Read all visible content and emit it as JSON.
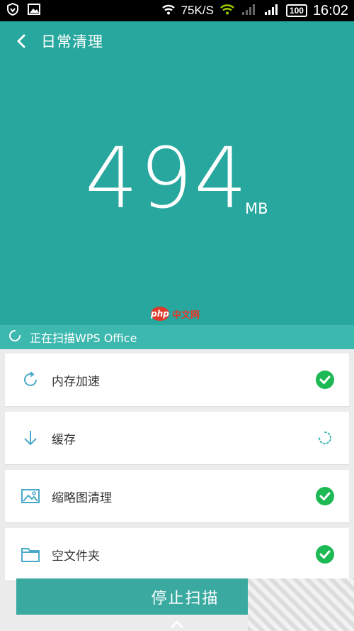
{
  "status_bar": {
    "speed": "75K/S",
    "battery": "100",
    "time": "16:02"
  },
  "header": {
    "title": "日常清理"
  },
  "summary": {
    "value": "494",
    "unit": "MB"
  },
  "watermark": {
    "logo": "php",
    "text": "中文网"
  },
  "scan": {
    "status_text": "正在扫描WPS Office"
  },
  "items": [
    {
      "label": "内存加速",
      "icon": "refresh-icon",
      "state": "done"
    },
    {
      "label": "缓存",
      "icon": "download-arrow-icon",
      "state": "scanning"
    },
    {
      "label": "缩略图清理",
      "icon": "image-icon",
      "state": "done"
    },
    {
      "label": "空文件夹",
      "icon": "folder-icon",
      "state": "done"
    }
  ],
  "actions": {
    "stop_label": "停止扫描"
  },
  "colors": {
    "primary": "#27a79e",
    "scan_bar": "#3db8af",
    "check": "#1db954",
    "icon_line": "#4aa9c9"
  }
}
